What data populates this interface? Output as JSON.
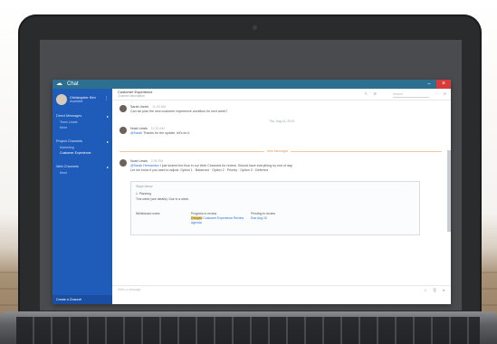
{
  "app": {
    "title": "Chat",
    "logo_glyph": "☁",
    "minimize_glyph": "–",
    "close_glyph": "×"
  },
  "sidebar": {
    "profile": {
      "name": "Christopher Kim",
      "status": "Available",
      "more_glyph": "⋮"
    },
    "sections": [
      {
        "label": "Direct Messages",
        "caret": "▸",
        "sub": [
          "Team Leads",
          "More"
        ]
      },
      {
        "label": "Project Channels",
        "caret": "▸",
        "sub": [
          "Marketing",
          "Customer Experience"
        ]
      },
      {
        "label": "Web Channels",
        "caret": "▸",
        "sub": [
          "More"
        ]
      }
    ],
    "footer": "Create a Channel"
  },
  "chat": {
    "title": "Customer Experience",
    "subtitle": "Channel description",
    "header_icons": [
      "✎",
      "⚙",
      "⋯",
      "⟳"
    ],
    "search_placeholder": "Search",
    "messages": [
      {
        "author": "Sarah Jones",
        "time": "11:24 AM",
        "text": "Can we plan the new customer experience workflow for next week?"
      },
      {
        "author": "Noah Lewis",
        "time": "11:30 AM",
        "mention": "@Sarah",
        "text": " Thanks for the update, let's do it."
      }
    ],
    "date_separator": "Thu, Aug 14, 2019",
    "unread_label": "New Messages",
    "message3": {
      "author": "Noah Lewis",
      "time": "2:05 PM",
      "line1_mention": "@Sarah Hernandez",
      "line1": " I just shared the flow in our Web Channels for review. Should have everything by end of day.",
      "line2": "Let me know if you want to adjust. Option 1 · Balanced · Option 2 · Priority · Option 3 · Deferred"
    },
    "quote": {
      "title": "Steps below",
      "line1": "1. Planning",
      "line2": "This week (see details). Due in a week.",
      "col1_title": "Whiteboard notes",
      "col2_title": "Progress to review",
      "col2_highlight": "Delayed",
      "col2_link": "Customer Experience Review",
      "col2_more": "Agenda",
      "col3_title": "Pending to review",
      "col3_link": "Due Aug 15"
    },
    "composer_placeholder": "Write a message",
    "composer_icons": [
      "☺",
      "⎘",
      "➤"
    ]
  }
}
